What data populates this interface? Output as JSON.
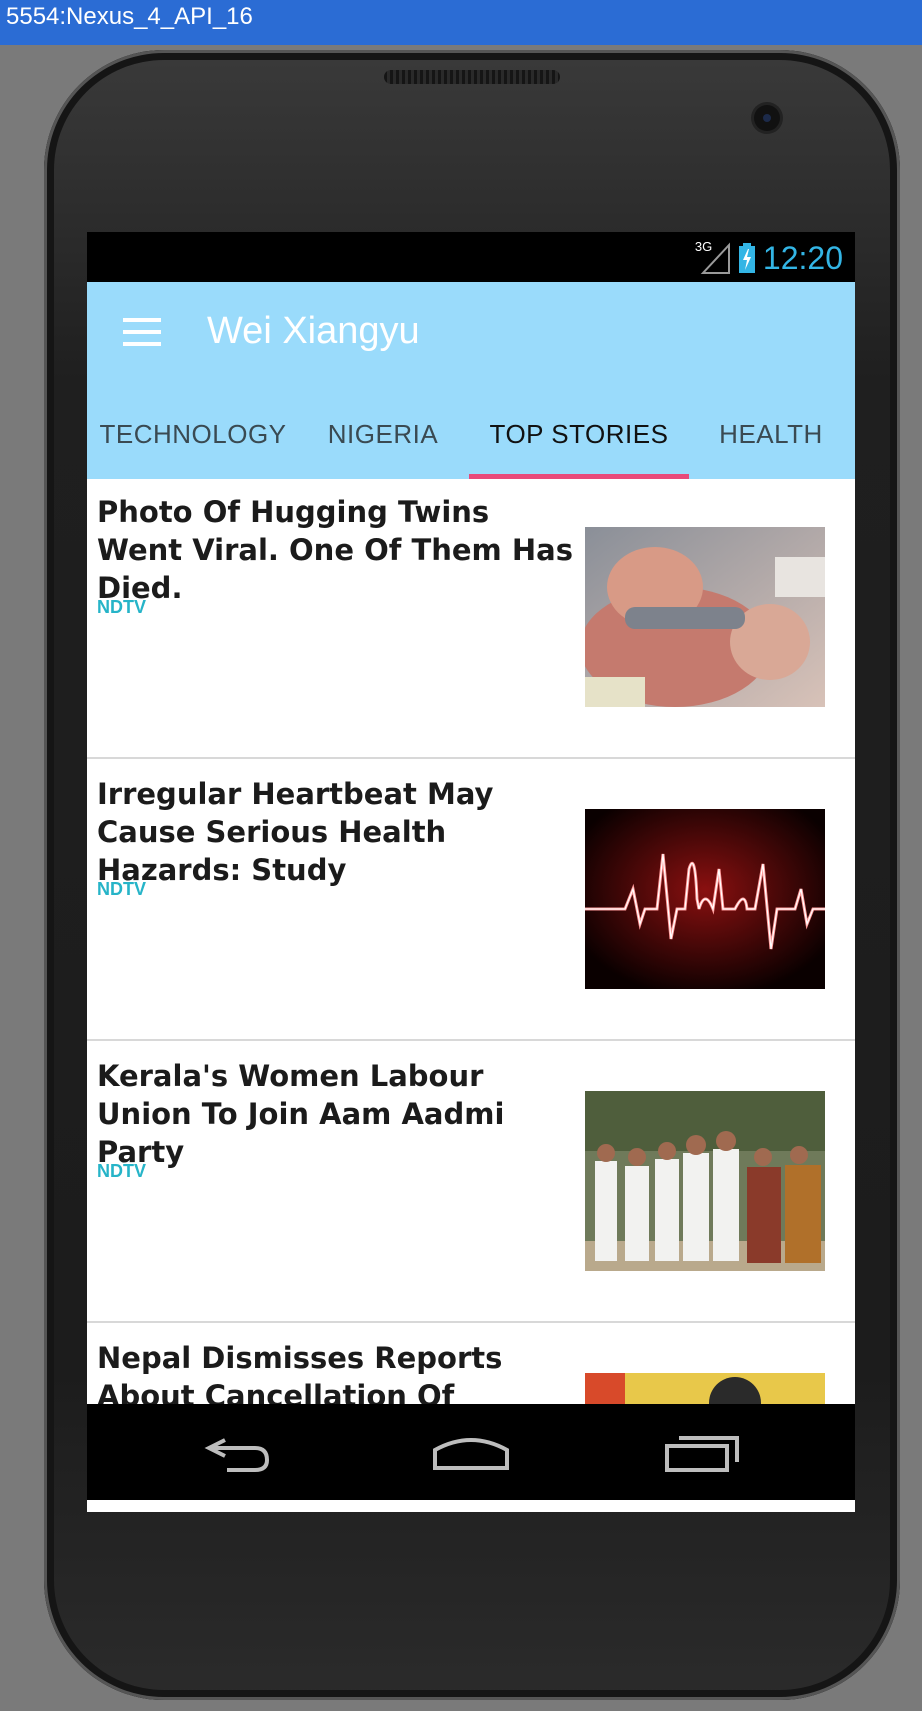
{
  "window": {
    "title": "5554:Nexus_4_API_16"
  },
  "status_bar": {
    "network": "3G",
    "time": "12:20"
  },
  "app_bar": {
    "title": "Wei Xiangyu"
  },
  "tabs": [
    {
      "label": "TECHNOLOGY",
      "active": false
    },
    {
      "label": "NIGERIA",
      "active": false
    },
    {
      "label": "TOP STORIES",
      "active": true
    },
    {
      "label": "HEALTH",
      "active": false
    }
  ],
  "stories": [
    {
      "title": "Photo Of Hugging Twins Went Viral. One Of Them Has Died.",
      "source": "NDTV",
      "image": "hugging-twins-photo"
    },
    {
      "title": "Irregular Heartbeat May Cause Serious Health Hazards: Study",
      "source": "NDTV",
      "image": "heartbeat-help-photo"
    },
    {
      "title": "Kerala's Women Labour Union To Join Aam Aadmi Party",
      "source": "NDTV",
      "image": "group-photo"
    },
    {
      "title": "Nepal Dismisses Reports About Cancellation Of President Xi",
      "source": "",
      "image": "xi-photo"
    }
  ],
  "colors": {
    "app_bar": "#9adbfb",
    "tab_indicator": "#e84a7a",
    "source": "#26b4c8",
    "clock": "#33b5e5"
  },
  "nav_icons": [
    "back-icon",
    "home-icon",
    "recent-apps-icon"
  ]
}
